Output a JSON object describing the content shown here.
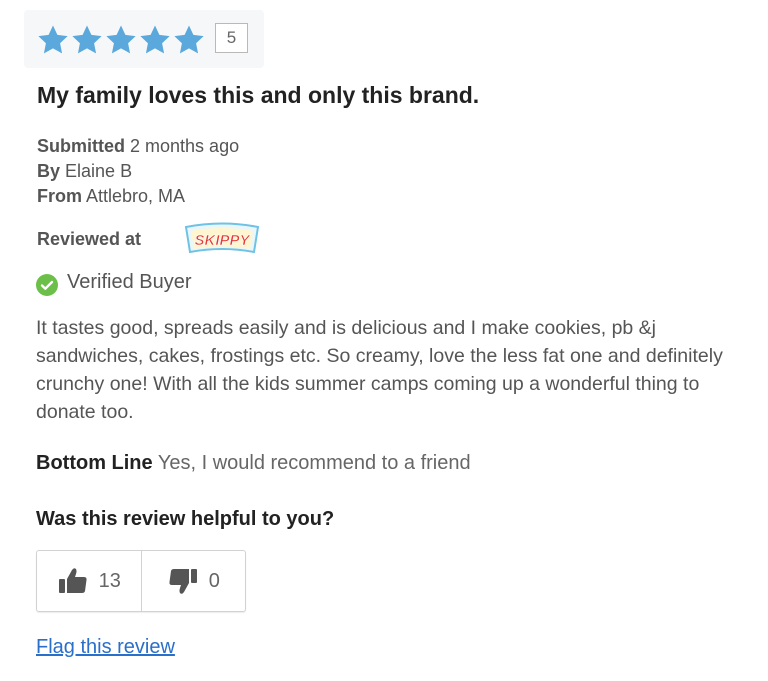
{
  "rating": {
    "stars": 5,
    "max_stars": 5,
    "count_badge": "5",
    "star_color": "#5aa8dc"
  },
  "review": {
    "title": "My family loves this and only this brand.",
    "submitted_label": "Submitted",
    "submitted_value": "2 months ago",
    "by_label": "By",
    "by_value": "Elaine B",
    "from_label": "From",
    "from_value": "Attlebro, MA",
    "reviewed_at_label": "Reviewed at",
    "reviewed_at_logo_text": "SKIPPY",
    "verified_text": "Verified Buyer",
    "verified_color": "#6cc04a",
    "body": "It tastes good, spreads easily and is delicious and I make cookies, pb &j sandwiches, cakes, frostings etc. So creamy, love the less fat one and definitely crunchy one! With all the kids summer camps coming up a wonderful thing to donate too.",
    "bottom_line_label": "Bottom Line",
    "bottom_line_value": "Yes, I would recommend to a friend"
  },
  "helpful": {
    "question": "Was this review helpful to you?",
    "upvotes": "13",
    "downvotes": "0",
    "upvote_icon": "thumbs-up-icon",
    "downvote_icon": "thumbs-down-icon"
  },
  "flag": {
    "label": "Flag this review",
    "color": "#2a6fc9"
  }
}
